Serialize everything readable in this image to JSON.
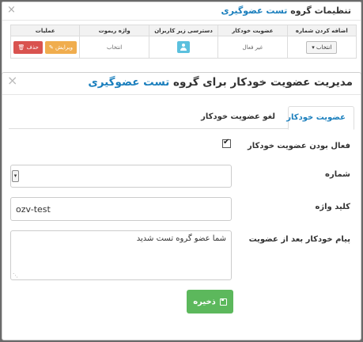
{
  "background": {
    "title_prefix": "تنظیمات گروه",
    "title_group": "تست عضوگیری",
    "close_glyph": "×",
    "table": {
      "headers": [
        "اضافه کردن شماره",
        "عضویت خودکار",
        "دسترسی زیر کاربران",
        "واژه ریموت",
        "عملیات"
      ],
      "row": {
        "add_number_button": "انتخاب ▾",
        "auto_membership": "غیر فعال",
        "subuser_access_icon": "user-icon",
        "remote_word": "انتخاب",
        "edit_button": "✎ ویرایش",
        "delete_button": "🗑 حذف"
      }
    }
  },
  "modal": {
    "title_prefix": "مدیریت عضویت خودکار برای گروه",
    "title_group": "تست عضوگیری",
    "close_glyph": "×",
    "tabs": [
      {
        "label": "عضویت خودکار",
        "active": true
      },
      {
        "label": "لغو عضویت خودکار",
        "active": false
      }
    ],
    "form": {
      "enable_label": "فعال بودن عضویت خودکار",
      "enable_checked": true,
      "number_label": "شماره",
      "number_value": "",
      "keyword_label": "کلید واژه",
      "keyword_value": "ozv-test",
      "message_label": "پیام خودکار بعد از عضویت",
      "message_value": "شما عضو گروه تست شدید",
      "save_label": "ذخیره",
      "save_icon": "floppy-disk-icon"
    }
  },
  "colors": {
    "accent": "#1b7fbd",
    "success": "#5cb85c",
    "danger": "#d9534f",
    "warning": "#f0ad4e",
    "info": "#5bc0de"
  }
}
